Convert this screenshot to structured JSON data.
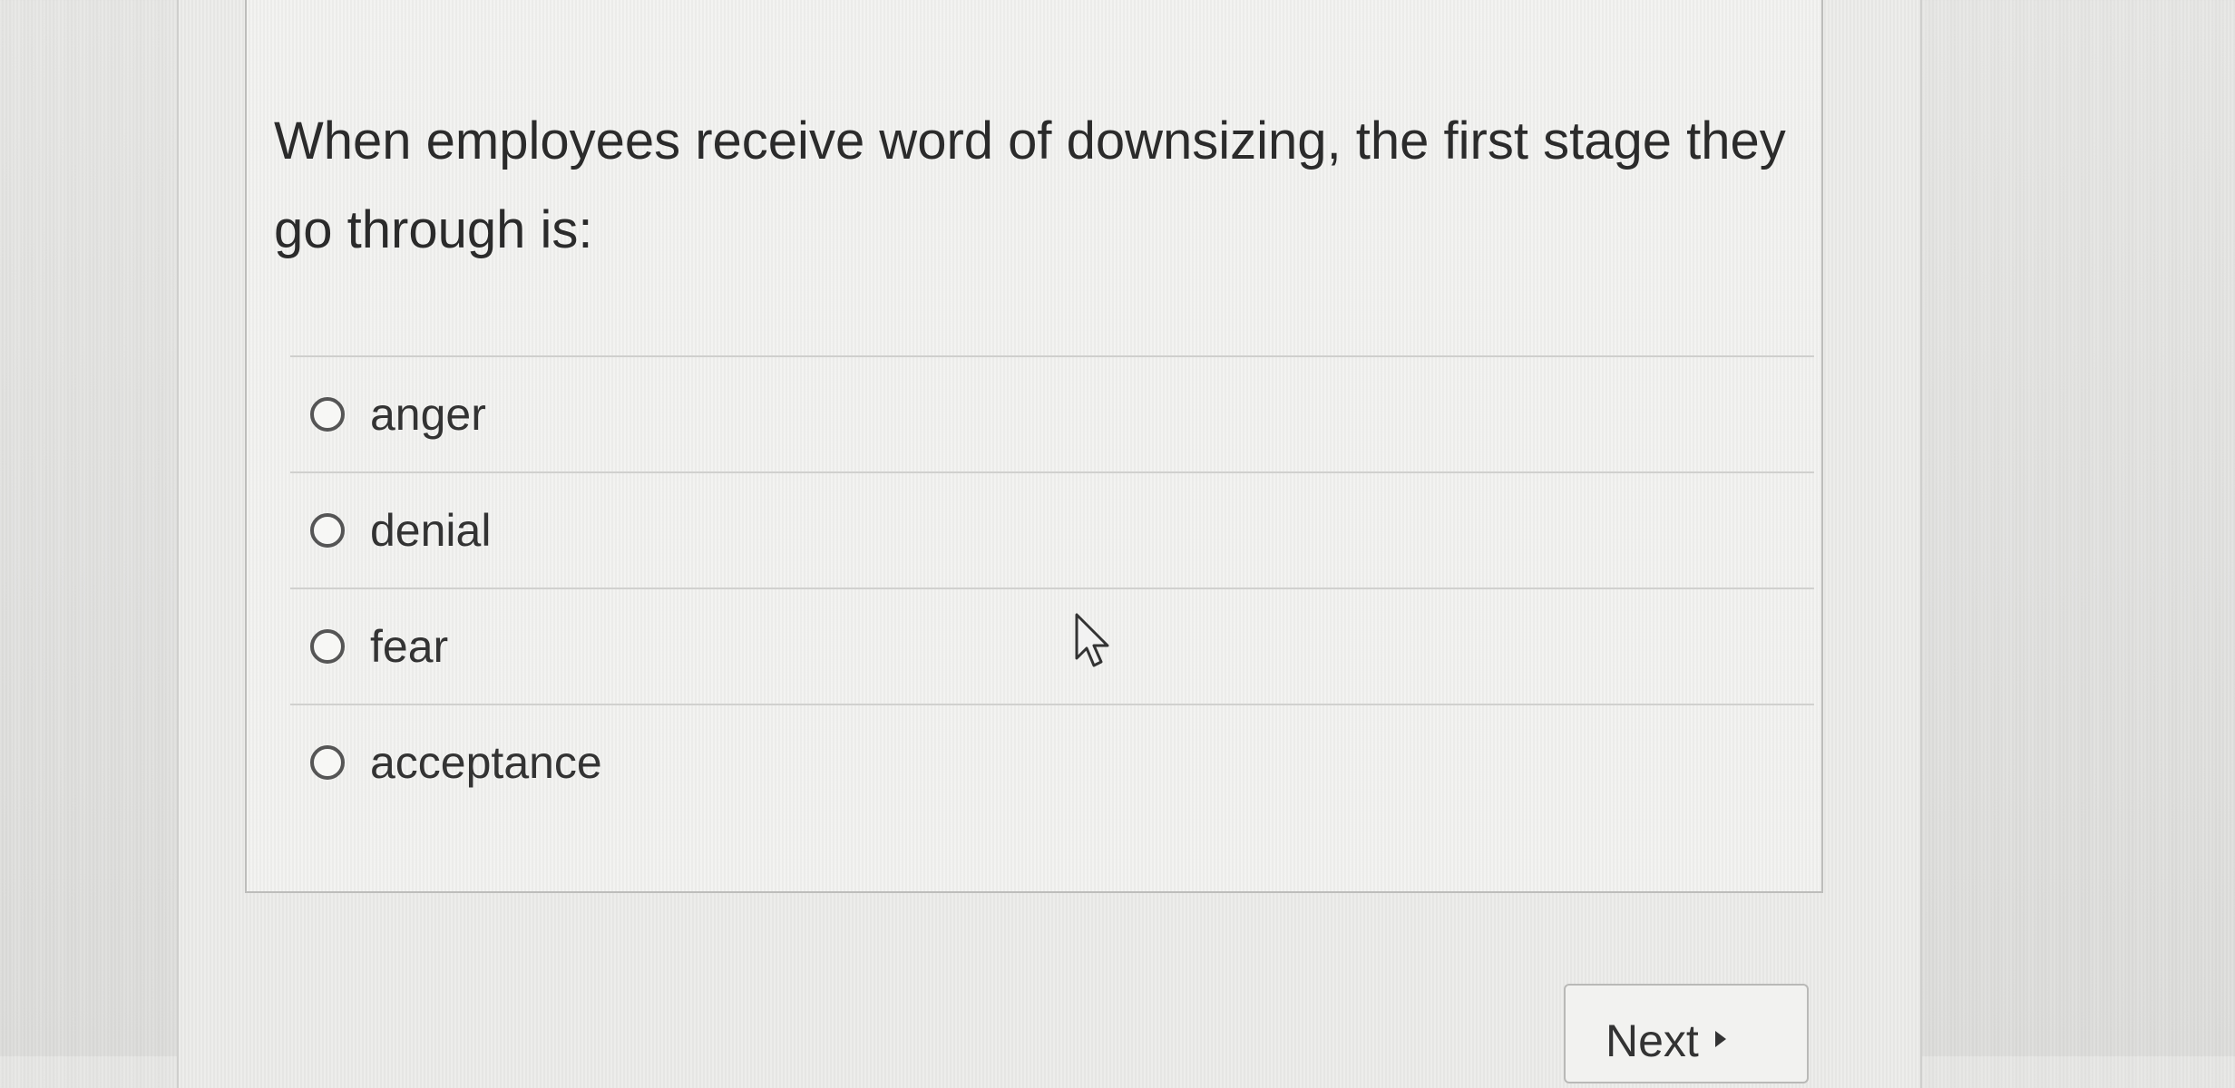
{
  "question": {
    "text": "When employees receive word of downsizing, the first stage they go through is:"
  },
  "options": [
    {
      "label": "anger",
      "selected": false
    },
    {
      "label": "denial",
      "selected": false
    },
    {
      "label": "fear",
      "selected": false
    },
    {
      "label": "acceptance",
      "selected": false
    }
  ],
  "navigation": {
    "next_label": "Next"
  },
  "icons": {
    "next": "play-triangle-icon",
    "cursor": "mouse-pointer-icon"
  }
}
